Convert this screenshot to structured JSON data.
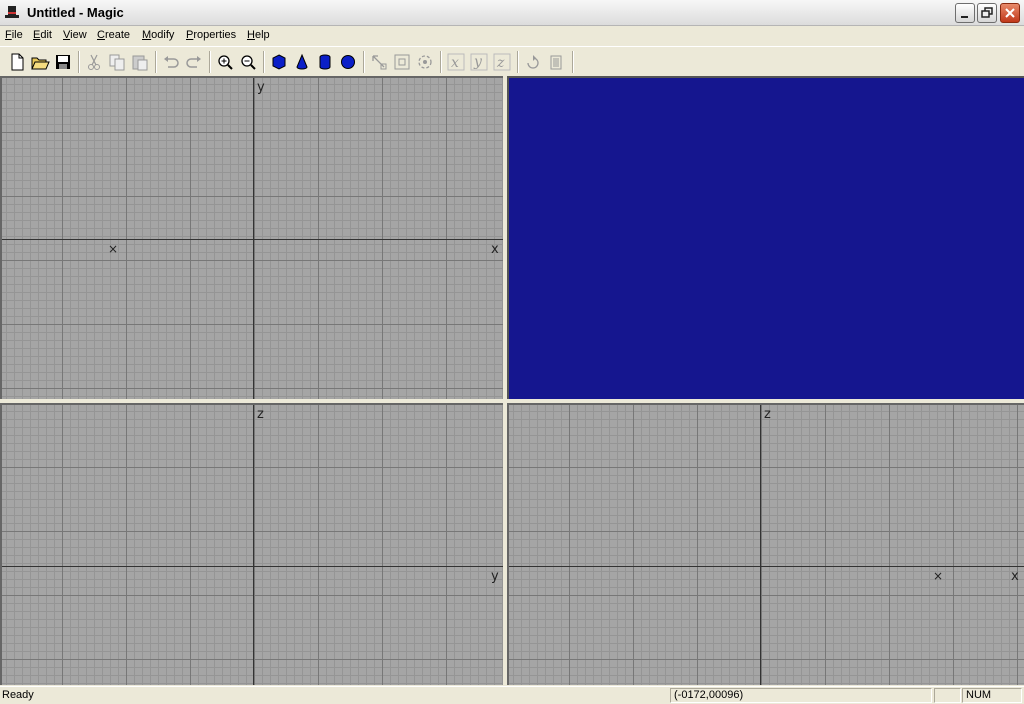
{
  "window": {
    "title": "Untitled - Magic"
  },
  "menu": {
    "items": [
      "File",
      "Edit",
      "View",
      "Create",
      "Modify",
      "Properties",
      "Help"
    ]
  },
  "toolbar": {
    "buttons": [
      "new-file-icon",
      "open-folder-icon",
      "save-icon",
      "cut-icon",
      "copy-icon",
      "paste-icon",
      "undo-icon",
      "redo-icon",
      "zoom-in-icon",
      "zoom-out-icon",
      "cube-icon",
      "cone-icon",
      "cylinder-icon",
      "sphere-icon",
      "move-icon",
      "scale-icon",
      "rotate-icon",
      "x-axis-icon",
      "y-axis-icon",
      "z-axis-icon",
      "rotate-view-icon",
      "delete-icon"
    ]
  },
  "viewports": {
    "top": {
      "v_label": "y",
      "h_label": "x",
      "marker": "×"
    },
    "perspective": {
      "background": "#15168f"
    },
    "side": {
      "v_label": "z",
      "h_label": "y"
    },
    "front": {
      "v_label": "z",
      "h_label": "x",
      "marker": "×"
    }
  },
  "status": {
    "text": "Ready",
    "coords": "(-0172,00096)",
    "num": "NUM"
  }
}
